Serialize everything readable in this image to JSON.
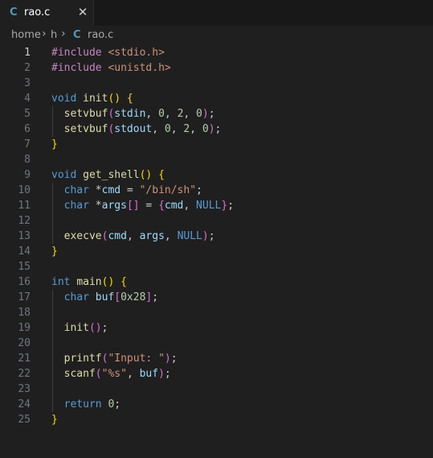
{
  "tab": {
    "icon": "c-file-icon",
    "icon_glyph": "C",
    "name": "rao.c",
    "close_glyph": "✕"
  },
  "breadcrumb": {
    "items": [
      "home",
      "h",
      "rao.c"
    ],
    "file_icon_glyph": "C",
    "separator": "›"
  },
  "editor": {
    "active_line": 1,
    "lines": [
      [
        [
          "pp",
          "#include "
        ],
        [
          "inc",
          "<stdio.h>"
        ]
      ],
      [
        [
          "pp",
          "#include "
        ],
        [
          "inc",
          "<unistd.h>"
        ]
      ],
      [],
      [
        [
          "kw",
          "void "
        ],
        [
          "fn",
          "init"
        ],
        [
          "b1",
          "() {"
        ]
      ],
      [
        [
          "p",
          "  "
        ],
        [
          "fn",
          "setvbuf"
        ],
        [
          "b2",
          "("
        ],
        [
          "var",
          "stdin"
        ],
        [
          "p",
          ", "
        ],
        [
          "num",
          "0"
        ],
        [
          "p",
          ", "
        ],
        [
          "num",
          "2"
        ],
        [
          "p",
          ", "
        ],
        [
          "num",
          "0"
        ],
        [
          "b2",
          ")"
        ],
        [
          "p",
          ";"
        ]
      ],
      [
        [
          "p",
          "  "
        ],
        [
          "fn",
          "setvbuf"
        ],
        [
          "b2",
          "("
        ],
        [
          "var",
          "stdout"
        ],
        [
          "p",
          ", "
        ],
        [
          "num",
          "0"
        ],
        [
          "p",
          ", "
        ],
        [
          "num",
          "2"
        ],
        [
          "p",
          ", "
        ],
        [
          "num",
          "0"
        ],
        [
          "b2",
          ")"
        ],
        [
          "p",
          ";"
        ]
      ],
      [
        [
          "b1",
          "}"
        ]
      ],
      [],
      [
        [
          "kw",
          "void "
        ],
        [
          "fn",
          "get_shell"
        ],
        [
          "b1",
          "() {"
        ]
      ],
      [
        [
          "p",
          "  "
        ],
        [
          "kw",
          "char "
        ],
        [
          "p",
          "*"
        ],
        [
          "var",
          "cmd"
        ],
        [
          "p",
          " = "
        ],
        [
          "str",
          "\"/bin/sh\""
        ],
        [
          "p",
          ";"
        ]
      ],
      [
        [
          "p",
          "  "
        ],
        [
          "kw",
          "char "
        ],
        [
          "p",
          "*"
        ],
        [
          "var",
          "args"
        ],
        [
          "b2",
          "[]"
        ],
        [
          "p",
          " = "
        ],
        [
          "b2",
          "{"
        ],
        [
          "var",
          "cmd"
        ],
        [
          "p",
          ", "
        ],
        [
          "const",
          "NULL"
        ],
        [
          "b2",
          "}"
        ],
        [
          "p",
          ";"
        ]
      ],
      [],
      [
        [
          "p",
          "  "
        ],
        [
          "fn",
          "execve"
        ],
        [
          "b2",
          "("
        ],
        [
          "var",
          "cmd"
        ],
        [
          "p",
          ", "
        ],
        [
          "var",
          "args"
        ],
        [
          "p",
          ", "
        ],
        [
          "const",
          "NULL"
        ],
        [
          "b2",
          ")"
        ],
        [
          "p",
          ";"
        ]
      ],
      [
        [
          "b1",
          "}"
        ]
      ],
      [],
      [
        [
          "kw",
          "int "
        ],
        [
          "fn",
          "main"
        ],
        [
          "b1",
          "() {"
        ]
      ],
      [
        [
          "p",
          "  "
        ],
        [
          "kw",
          "char "
        ],
        [
          "var",
          "buf"
        ],
        [
          "b2",
          "["
        ],
        [
          "num",
          "0x28"
        ],
        [
          "b2",
          "]"
        ],
        [
          "p",
          ";"
        ]
      ],
      [],
      [
        [
          "p",
          "  "
        ],
        [
          "fn",
          "init"
        ],
        [
          "b2",
          "()"
        ],
        [
          "p",
          ";"
        ]
      ],
      [],
      [
        [
          "p",
          "  "
        ],
        [
          "fn",
          "printf"
        ],
        [
          "b2",
          "("
        ],
        [
          "str",
          "\"Input: \""
        ],
        [
          "b2",
          ")"
        ],
        [
          "p",
          ";"
        ]
      ],
      [
        [
          "p",
          "  "
        ],
        [
          "fn",
          "scanf"
        ],
        [
          "b2",
          "("
        ],
        [
          "str",
          "\"%s\""
        ],
        [
          "p",
          ", "
        ],
        [
          "var",
          "buf"
        ],
        [
          "b2",
          ")"
        ],
        [
          "p",
          ";"
        ]
      ],
      [],
      [
        [
          "p",
          "  "
        ],
        [
          "kw",
          "return "
        ],
        [
          "num",
          "0"
        ],
        [
          "p",
          ";"
        ]
      ],
      [
        [
          "b1",
          "}"
        ]
      ]
    ]
  }
}
